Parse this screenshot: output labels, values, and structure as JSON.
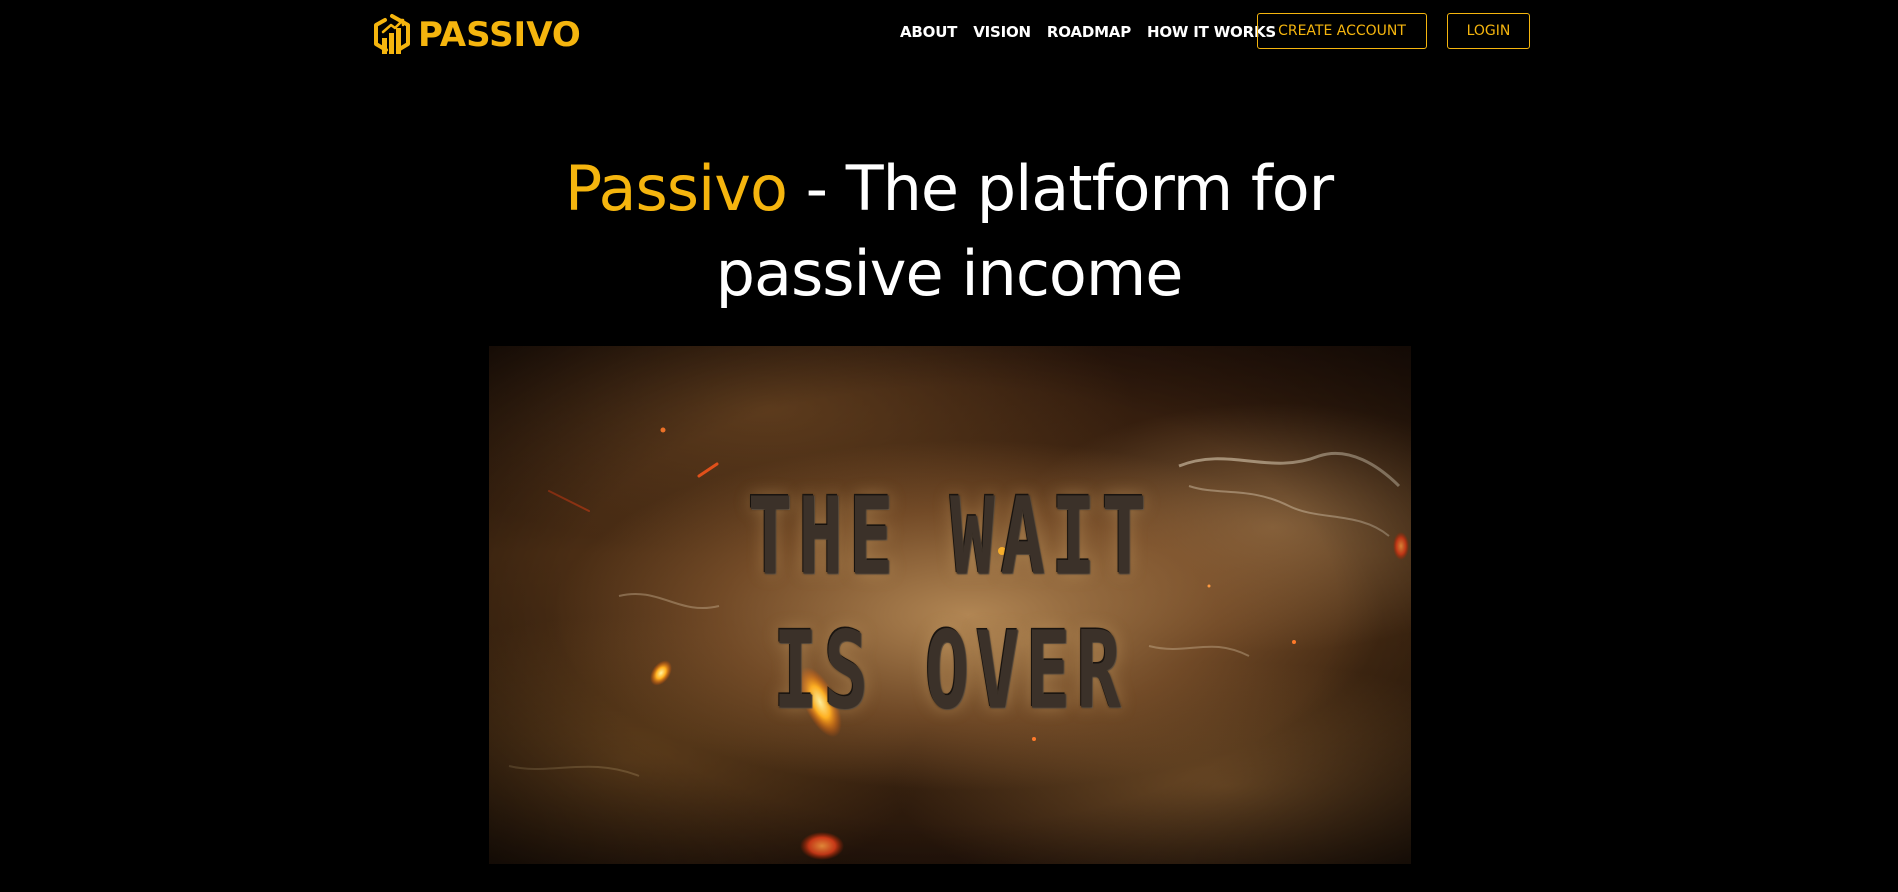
{
  "header": {
    "brand_name": "PASSIVO",
    "logo_icon": "bar-chart-hexagon-icon",
    "nav": [
      {
        "label": "ABOUT"
      },
      {
        "label": "VISION"
      },
      {
        "label": "ROADMAP"
      },
      {
        "label": "HOW IT WORKS"
      }
    ],
    "create_account_label": "CREATE ACCOUNT",
    "login_label": "LOGIN"
  },
  "hero": {
    "title_accent": "Passivo",
    "title_rest": " - The platform for passive income"
  },
  "media": {
    "line1": "THE WAIT",
    "line2": "IS OVER"
  },
  "colors": {
    "background": "#000000",
    "accent": "#f5b50e",
    "text": "#ffffff"
  }
}
